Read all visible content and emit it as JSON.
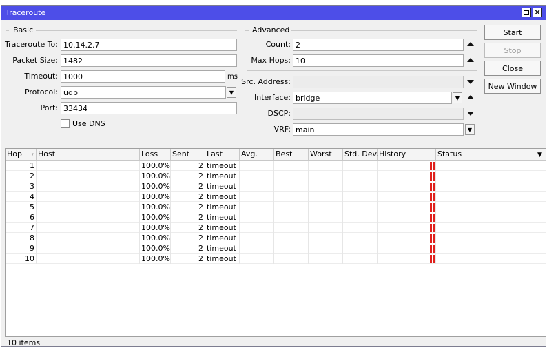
{
  "window": {
    "title": "Traceroute"
  },
  "basic": {
    "heading": "Basic",
    "traceroute_to": {
      "label": "Traceroute To:",
      "value": "10.14.2.7"
    },
    "packet_size": {
      "label": "Packet Size:",
      "value": "1482"
    },
    "timeout": {
      "label": "Timeout:",
      "value": "1000",
      "unit": "ms"
    },
    "protocol": {
      "label": "Protocol:",
      "value": "udp"
    },
    "port": {
      "label": "Port:",
      "value": "33434"
    },
    "use_dns": {
      "label": "Use DNS",
      "checked": false
    }
  },
  "advanced": {
    "heading": "Advanced",
    "count": {
      "label": "Count:",
      "value": "2"
    },
    "max_hops": {
      "label": "Max Hops:",
      "value": "10"
    },
    "src_address": {
      "label": "Src. Address:",
      "value": ""
    },
    "interface": {
      "label": "Interface:",
      "value": "bridge"
    },
    "dscp": {
      "label": "DSCP:",
      "value": ""
    },
    "vrf": {
      "label": "VRF:",
      "value": "main"
    }
  },
  "buttons": {
    "start": "Start",
    "stop": "Stop",
    "close": "Close",
    "new_window": "New Window"
  },
  "table": {
    "columns": [
      "Hop",
      "Host",
      "Loss",
      "Sent",
      "Last",
      "Avg.",
      "Best",
      "Worst",
      "Std. Dev.",
      "History",
      "Status"
    ],
    "rows": [
      {
        "hop": "1",
        "host": "",
        "loss": "100.0%",
        "sent": "2",
        "last": "timeout"
      },
      {
        "hop": "2",
        "host": "",
        "loss": "100.0%",
        "sent": "2",
        "last": "timeout"
      },
      {
        "hop": "3",
        "host": "",
        "loss": "100.0%",
        "sent": "2",
        "last": "timeout"
      },
      {
        "hop": "4",
        "host": "",
        "loss": "100.0%",
        "sent": "2",
        "last": "timeout"
      },
      {
        "hop": "5",
        "host": "",
        "loss": "100.0%",
        "sent": "2",
        "last": "timeout"
      },
      {
        "hop": "6",
        "host": "",
        "loss": "100.0%",
        "sent": "2",
        "last": "timeout"
      },
      {
        "hop": "7",
        "host": "",
        "loss": "100.0%",
        "sent": "2",
        "last": "timeout"
      },
      {
        "hop": "8",
        "host": "",
        "loss": "100.0%",
        "sent": "2",
        "last": "timeout"
      },
      {
        "hop": "9",
        "host": "",
        "loss": "100.0%",
        "sent": "2",
        "last": "timeout"
      },
      {
        "hop": "10",
        "host": "",
        "loss": "100.0%",
        "sent": "2",
        "last": "timeout"
      }
    ]
  },
  "status_bar": {
    "items": "10 items"
  },
  "colors": {
    "titlebar": "#4d4ee8",
    "history_bar": "#e0201c"
  }
}
